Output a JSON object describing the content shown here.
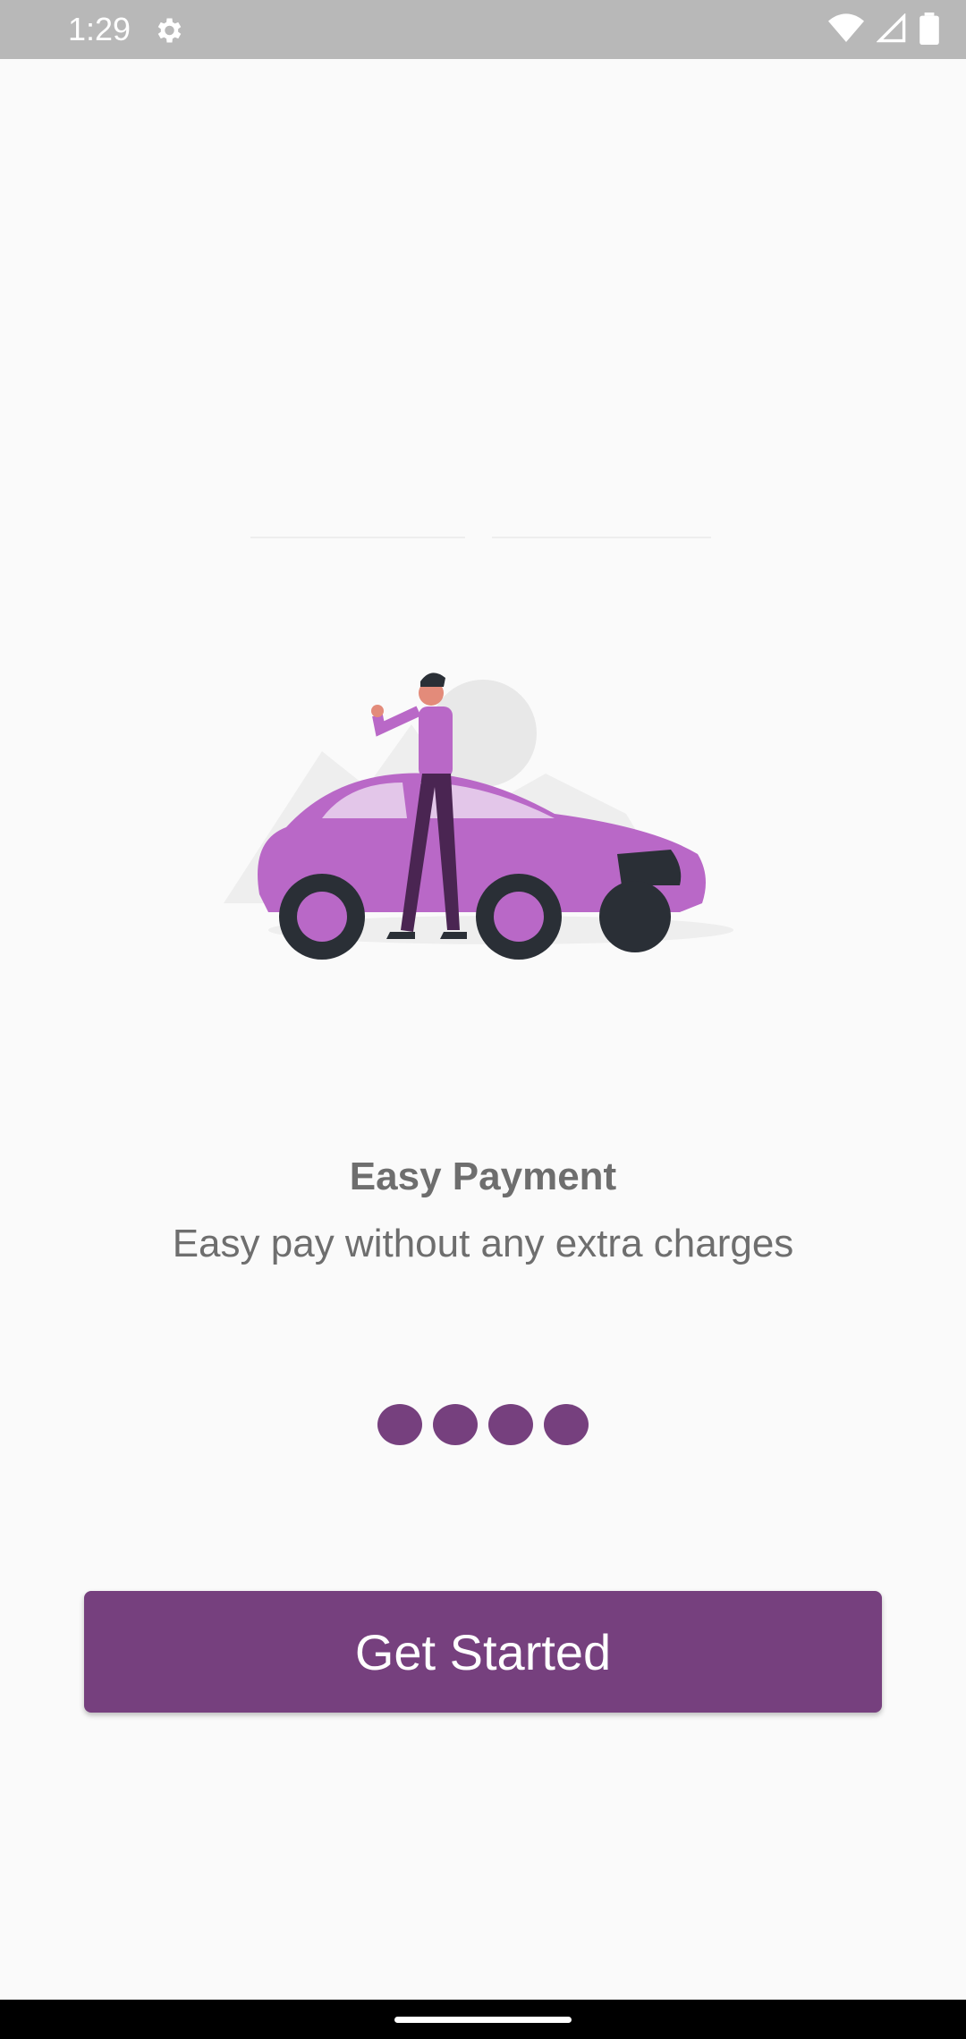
{
  "status_bar": {
    "time": "1:29",
    "icons": [
      "settings-gear-icon",
      "wifi-icon",
      "cellular-signal-icon",
      "battery-icon"
    ]
  },
  "onboarding": {
    "illustration": "person-leaning-on-car-illustration",
    "title": "Easy Payment",
    "subtitle": "Easy pay without any extra charges",
    "page_indicator": {
      "count": 4
    },
    "cta_label": "Get Started"
  },
  "colors": {
    "primary": "#76407e",
    "car": "#b968c7",
    "status_bar": "#b8b8b8",
    "text": "#6e6e6e",
    "background": "#fafafa"
  }
}
